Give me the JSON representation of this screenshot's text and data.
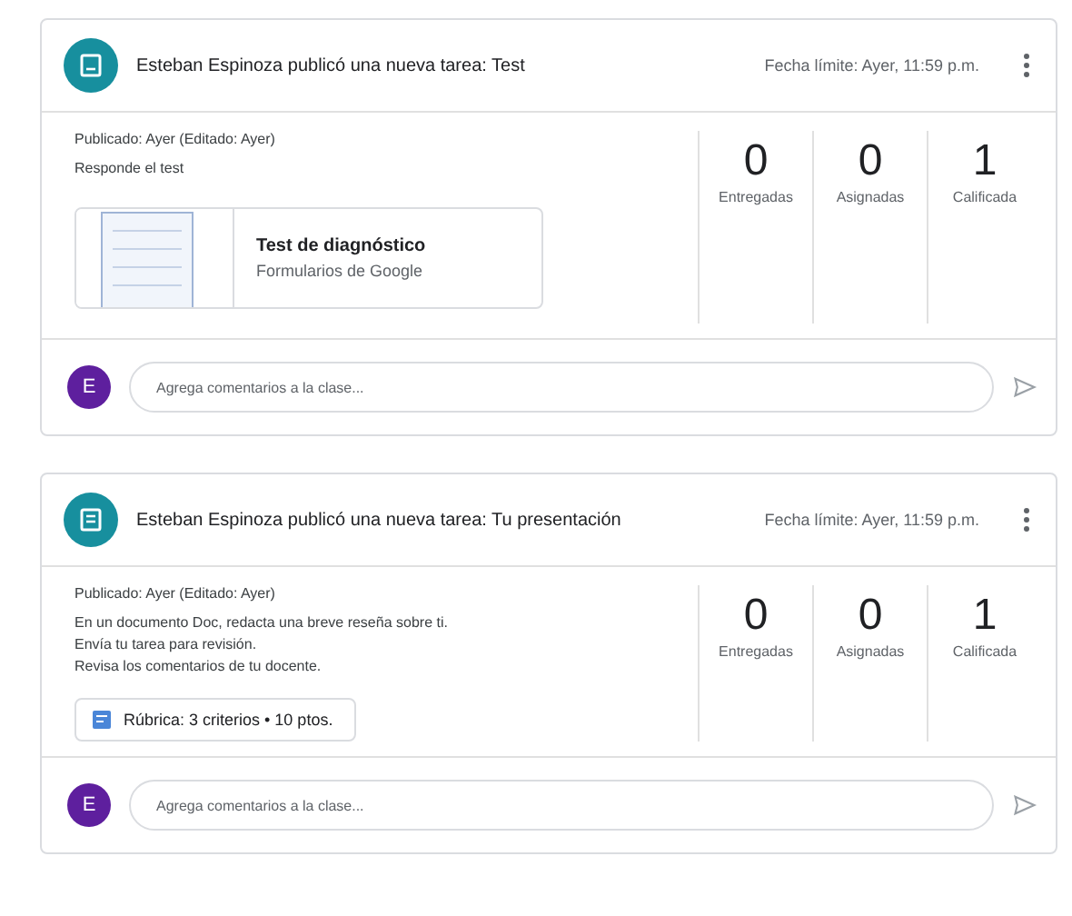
{
  "posts": [
    {
      "kind": "form",
      "title": "Esteban Espinoza publicó una nueva tarea: Test",
      "due": "Fecha límite: Ayer, 11:59 p.m.",
      "published": "Publicado: Ayer (Editado: Ayer)",
      "lines": [
        "Responde el test"
      ],
      "stats": [
        {
          "value": "0",
          "label": "Entregadas"
        },
        {
          "value": "0",
          "label": "Asignadas"
        },
        {
          "value": "1",
          "label": "Calificada"
        }
      ],
      "attachment": {
        "title": "Test de diagnóstico",
        "subtitle": "Formularios de Google"
      },
      "comment": {
        "avatar": "E",
        "placeholder": "Agrega comentarios a la clase..."
      }
    },
    {
      "kind": "rubric",
      "title": "Esteban Espinoza publicó una nueva tarea: Tu presentación",
      "due": "Fecha límite: Ayer, 11:59 p.m.",
      "published": "Publicado: Ayer (Editado: Ayer)",
      "lines": [
        "En un documento Doc, redacta una breve reseña sobre ti.",
        "Envía tu tarea para revisión.",
        "Revisa los comentarios de tu docente."
      ],
      "stats": [
        {
          "value": "0",
          "label": "Entregadas"
        },
        {
          "value": "0",
          "label": "Asignadas"
        },
        {
          "value": "1",
          "label": "Calificada"
        }
      ],
      "rubric": "Rúbrica: 3 criterios • 10 ptos.",
      "comment": {
        "avatar": "E",
        "placeholder": "Agrega comentarios a la clase..."
      }
    }
  ]
}
